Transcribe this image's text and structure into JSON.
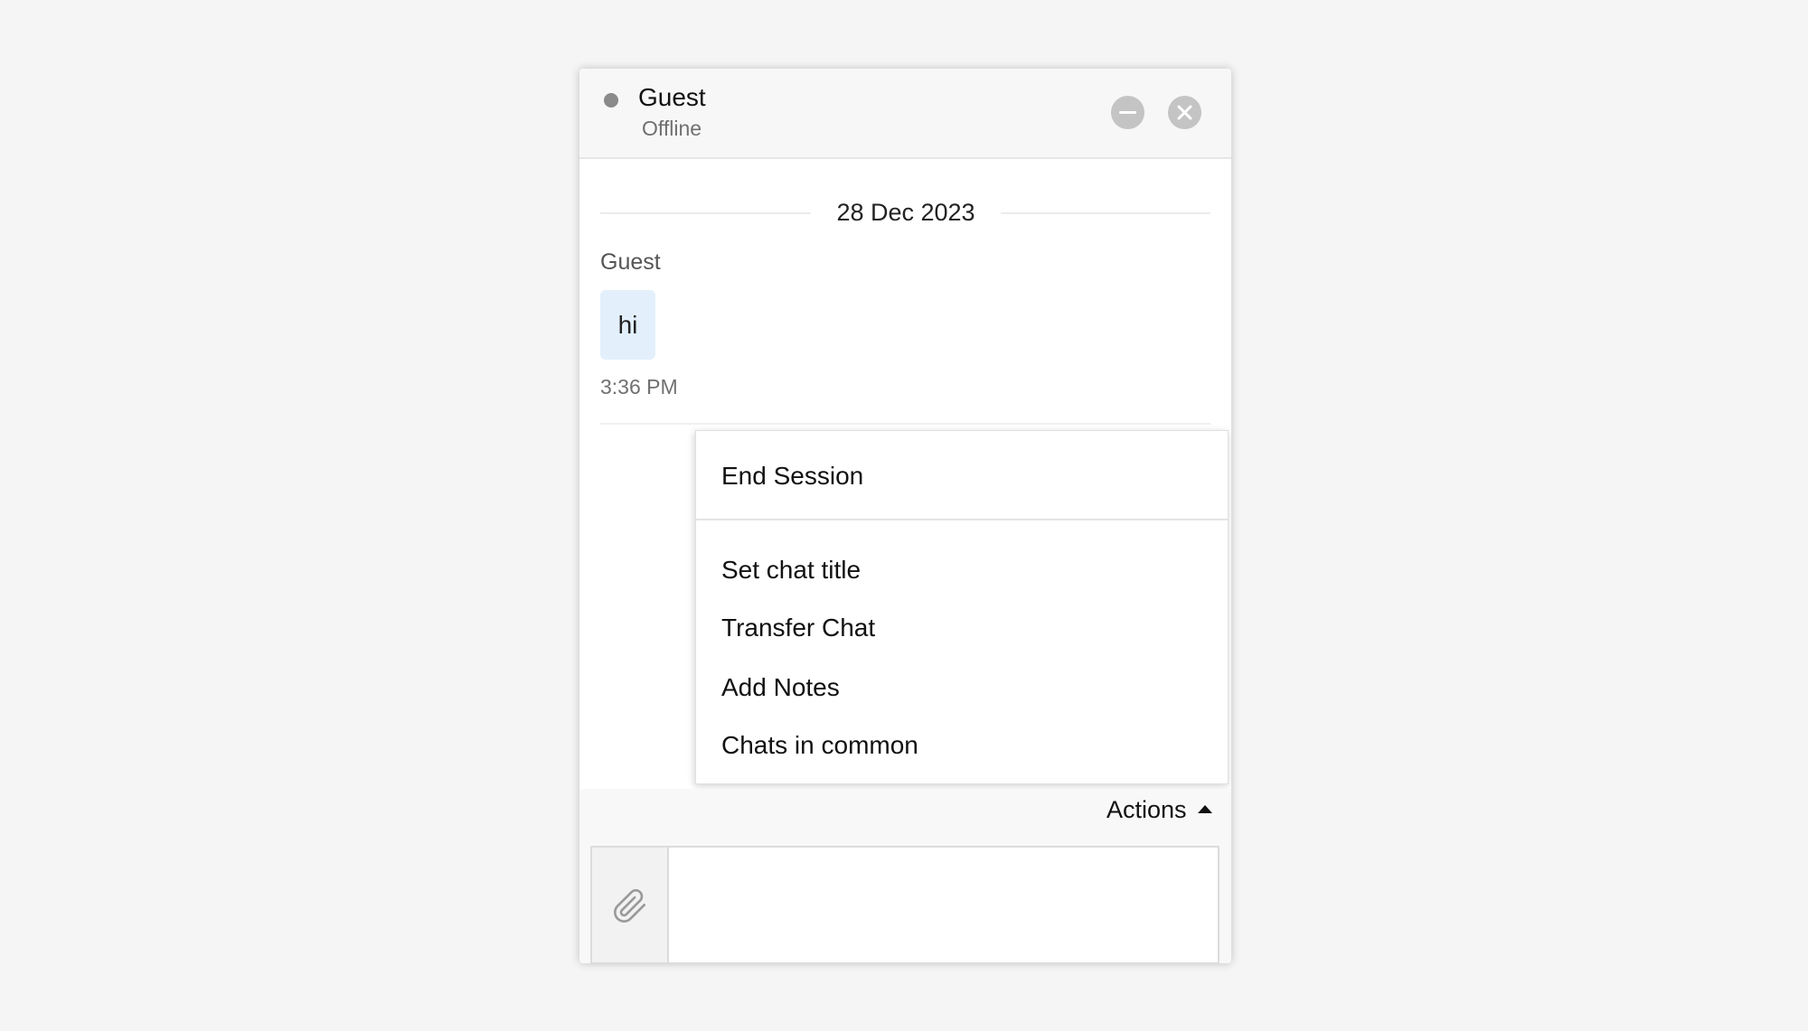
{
  "header": {
    "name": "Guest",
    "status": "Offline",
    "status_color": "#8a8a8a"
  },
  "conversation": {
    "date": "28 Dec 2023",
    "messages": [
      {
        "sender": "Guest",
        "text": "hi",
        "time": "3:36 PM",
        "bubble_color": "#e3f0fc"
      }
    ]
  },
  "actions_menu": {
    "primary": "End Session",
    "items": [
      "Set chat title",
      "Transfer Chat",
      "Add Notes",
      "Chats in common"
    ]
  },
  "actions_bar": {
    "label": "Actions",
    "icon": "caret-up-icon"
  },
  "composer": {
    "attach_icon": "paperclip-icon",
    "value": ""
  }
}
